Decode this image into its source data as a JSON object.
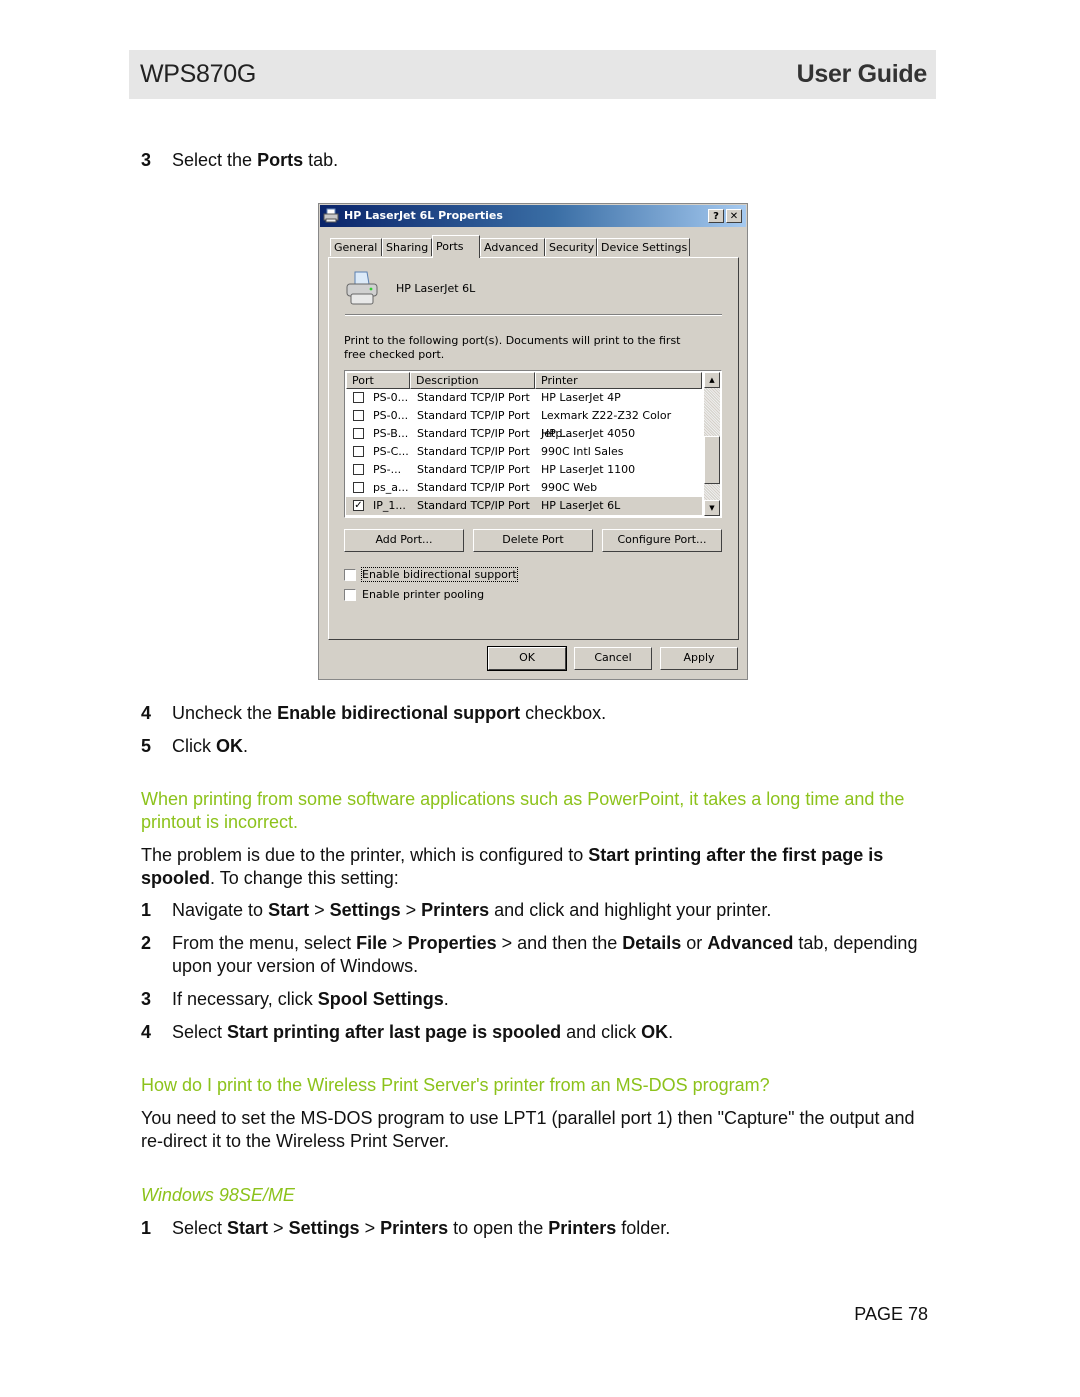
{
  "header": {
    "product": "WPS870G",
    "doc_title": "User Guide"
  },
  "step3": {
    "num": "3",
    "pre": "Select the ",
    "bold": "Ports",
    "post": " tab."
  },
  "dialog": {
    "title": "HP LaserJet 6L Properties",
    "help_btn": "?",
    "close_btn": "✕",
    "tabs": [
      "General",
      "Sharing",
      "Ports",
      "Advanced",
      "Security",
      "Device Settings"
    ],
    "active_tab": "Ports",
    "printer_name": "HP LaserJet 6L",
    "description": "Print to the following port(s). Documents will print to the first free checked port.",
    "columns": [
      "Port",
      "Description",
      "Printer"
    ],
    "rows": [
      {
        "checked": false,
        "port": "PS-0...",
        "description": "Standard TCP/IP Port",
        "printer": "HP LaserJet 4P"
      },
      {
        "checked": false,
        "port": "PS-0...",
        "description": "Standard TCP/IP Port",
        "printer": "Lexmark Z22-Z32 Color Jetp..."
      },
      {
        "checked": false,
        "port": "PS-B...",
        "description": "Standard TCP/IP Port",
        "printer": "HP LaserJet 4050"
      },
      {
        "checked": false,
        "port": "PS-C...",
        "description": "Standard TCP/IP Port",
        "printer": "990C Intl Sales"
      },
      {
        "checked": false,
        "port": "PS-...",
        "description": "Standard TCP/IP Port",
        "printer": "HP LaserJet 1100"
      },
      {
        "checked": false,
        "port": "ps_a...",
        "description": "Standard TCP/IP Port",
        "printer": "990C Web"
      },
      {
        "checked": true,
        "port": "IP_1...",
        "description": "Standard TCP/IP Port",
        "printer": "HP LaserJet 6L",
        "selected": true
      }
    ],
    "buttons": {
      "add_port": "Add Port...",
      "delete_port": "Delete Port",
      "configure_port": "Configure Port..."
    },
    "checkboxes": {
      "bidirectional": {
        "label": "Enable bidirectional support",
        "checked": false
      },
      "pooling": {
        "label": "Enable printer pooling",
        "checked": false
      }
    },
    "footer": {
      "ok": "OK",
      "cancel": "Cancel",
      "apply": "Apply"
    }
  },
  "step4": {
    "num": "4",
    "pre": "Uncheck the ",
    "bold": "Enable bidirectional support",
    "post": " checkbox."
  },
  "step5": {
    "num": "5",
    "pre": "Click ",
    "bold": "OK",
    "post": "."
  },
  "faq1": {
    "question": "When printing from some software applications such as PowerPoint, it takes a long time and the printout is incorrect.",
    "answer_pre": "The problem is due to the printer, which is configured to ",
    "answer_bold": "Start printing after the first page is spooled",
    "answer_post": ". To change this setting:",
    "steps": [
      {
        "num": "1",
        "parts": [
          [
            "Navigate to ",
            false
          ],
          [
            "Start",
            true
          ],
          [
            " > ",
            false
          ],
          [
            "Settings",
            true
          ],
          [
            " > ",
            false
          ],
          [
            "Printers",
            true
          ],
          [
            " and click and highlight your printer.",
            false
          ]
        ]
      },
      {
        "num": "2",
        "parts": [
          [
            "From the menu, select ",
            false
          ],
          [
            "File",
            true
          ],
          [
            " > ",
            false
          ],
          [
            "Properties",
            true
          ],
          [
            " > and then the ",
            false
          ],
          [
            "Details",
            true
          ],
          [
            " or ",
            false
          ],
          [
            "Advanced",
            true
          ],
          [
            " tab, depending upon your version of Windows.",
            false
          ]
        ]
      },
      {
        "num": "3",
        "parts": [
          [
            "If necessary, click ",
            false
          ],
          [
            "Spool Settings",
            true
          ],
          [
            ".",
            false
          ]
        ]
      },
      {
        "num": "4",
        "parts": [
          [
            "Select ",
            false
          ],
          [
            "Start printing after last page is spooled",
            true
          ],
          [
            " and click ",
            false
          ],
          [
            "OK",
            true
          ],
          [
            ".",
            false
          ]
        ]
      }
    ]
  },
  "faq2": {
    "question": "How do I print to the Wireless Print Server's printer from an MS-DOS program?",
    "answer": "You need to set the MS-DOS program to use LPT1 (parallel port 1) then \"Capture\" the output and re-direct it to the Wireless Print Server.",
    "subheading": "Windows 98SE/ME",
    "steps": [
      {
        "num": "1",
        "parts": [
          [
            "Select ",
            false
          ],
          [
            "Start",
            true
          ],
          [
            " > ",
            false
          ],
          [
            "Settings",
            true
          ],
          [
            " > ",
            false
          ],
          [
            "Printers",
            true
          ],
          [
            " to open the ",
            false
          ],
          [
            "Printers",
            true
          ],
          [
            " folder.",
            false
          ]
        ]
      }
    ]
  },
  "footer": {
    "page": "PAGE 78"
  },
  "colors": {
    "accent_green": "#8cc21b",
    "header_band": "#e6e6e6",
    "dialog_face": "#d4d0c8",
    "titlebar_dark": "#0a246a"
  }
}
